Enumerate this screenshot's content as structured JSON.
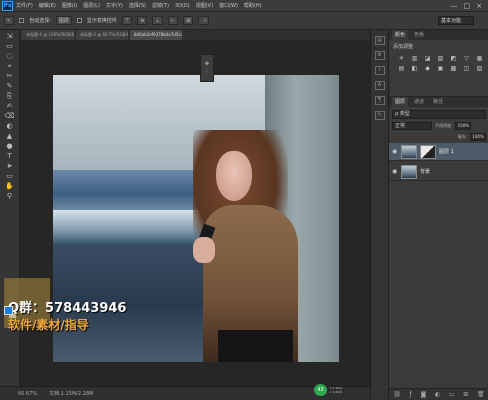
{
  "app": {
    "logo": "Ps"
  },
  "menubar": {
    "items": [
      "文件(F)",
      "编辑(E)",
      "图像(I)",
      "图层(L)",
      "文字(Y)",
      "选择(S)",
      "滤镜(T)",
      "3D(D)",
      "视图(V)",
      "窗口(W)",
      "帮助(H)"
    ],
    "controls": [
      "—",
      "□",
      "×"
    ]
  },
  "options": {
    "tool_preset": "↖",
    "auto_select_label": "自动选择:",
    "auto_select_value": "图层",
    "show_transform_label": "显示变换控件",
    "workspace": "基本功能"
  },
  "tabs": [
    {
      "label": "未标题-1 @ 100%(RGB/8)",
      "active": false
    },
    {
      "label": "未标题-2 @ 66.7%(RGB/8)",
      "active": false
    },
    {
      "label": "8d0ab2ef0378b4a7d5c4.jpg @ 66.7%",
      "active": true
    }
  ],
  "tools": [
    "⇲",
    "▭",
    "◌",
    "⌖",
    "✂",
    "✎",
    "⎘",
    "✍",
    "⌫",
    "◐",
    "▲",
    "●",
    "T",
    "➤",
    "▭",
    "✋",
    "⚲"
  ],
  "watermark": {
    "qq": "Q群：578443946",
    "line2": "软件/素材/指导"
  },
  "status": {
    "zoom": "66.67%",
    "doc": "文档:1.15M/2.28M"
  },
  "tray": {
    "badge": "43",
    "line1": "↑ 0.1K/S",
    "line2": "↓ 0.2K/S"
  },
  "right_panel": {
    "tabs": [
      "颜色",
      "色板"
    ],
    "adjust_title": "添加调整",
    "adjust_row1": [
      "☀",
      "▥",
      "◪",
      "▨",
      "◩",
      "▽",
      "▦"
    ],
    "adjust_row2": [
      "▤",
      "◧",
      "◆",
      "▣",
      "▩",
      "◫",
      "▧"
    ],
    "layer_tabs": [
      "图层",
      "通道",
      "路径"
    ],
    "filter": "ρ 类型",
    "blend_mode": "正常",
    "opacity_label": "不透明度:",
    "opacity": "100%",
    "fill_label": "填充:",
    "fill": "100%",
    "layers": [
      {
        "name": "图层 1",
        "selected": true
      },
      {
        "name": "背景",
        "selected": false
      }
    ]
  }
}
